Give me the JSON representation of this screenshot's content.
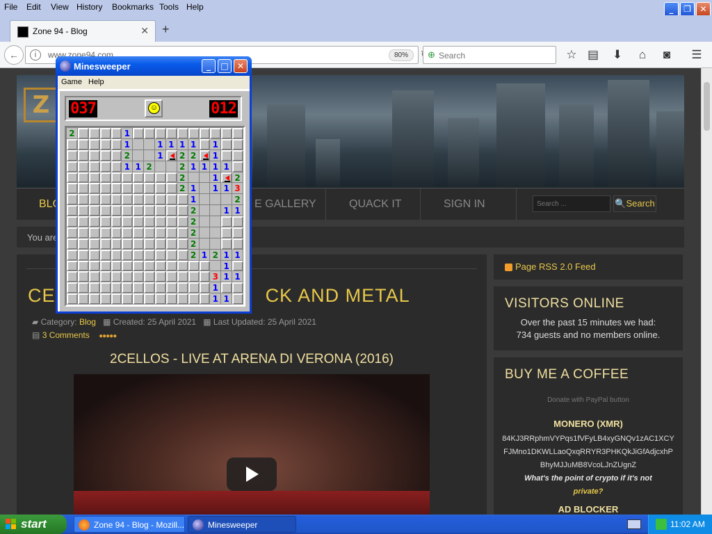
{
  "firefox": {
    "menu": [
      "File",
      "Edit",
      "View",
      "History",
      "Bookmarks",
      "Tools",
      "Help"
    ],
    "tab_title": "Zone 94 - Blog",
    "url": "www.zone94.com",
    "zoom": "80%",
    "search_placeholder": "Search"
  },
  "site": {
    "nav": [
      "BLO",
      "E GALLERY",
      "QUACK IT",
      "SIGN IN"
    ],
    "search_placeholder": "Search ...",
    "search_button": "Search",
    "breadcrumb": "You are",
    "article": {
      "title_left": "CEL",
      "title_right": "CK AND METAL",
      "category_label": "Category:",
      "category": "Blog",
      "created": "Created: 25 April 2021",
      "updated": "Last Updated: 25 April 2021",
      "comments": "3 Comments",
      "video_title": "2CELLOS - LIVE AT ARENA DI VERONA (2016)"
    },
    "sidebar": {
      "rss": "Page RSS 2.0 Feed",
      "visitors_title": "VISITORS ONLINE",
      "visitors_line1": "Over the past 15 minutes we had:",
      "visitors_line2": "734 guests and no members online.",
      "coffee_title": "BUY ME A COFFEE",
      "donate": "Donate with PayPal button",
      "monero_title": "MONERO (XMR)",
      "monero_addr1": "84KJ3RRphmVYPqs1fVFyLB4xyGNQv1zAC1XCY",
      "monero_addr2": "FJMno1DKWLLaoQxqRRYR3PHKQkJiGfAdjcxhP",
      "monero_addr3": "BhyMJJuMB8VcoLJnZUgnZ",
      "question1": "What's the point of crypto if it's not",
      "question2": "private?",
      "adblocker": "AD BLOCKER"
    }
  },
  "minesweeper": {
    "title": "Minesweeper",
    "menu": [
      "Game",
      "Help"
    ],
    "mines_left": "037",
    "time": "012",
    "face": "smiley",
    "grid_size": 16,
    "grid": [
      "2UUUU1UUUUUUUUUU",
      "UUUUU1..1111U1UU",
      "UUUUU2..1F22F1UU",
      "UUUUU112..21111U",
      "UUUUUUUUUU2..1F2",
      "UUUUUUUUUU21.113",
      "UUUUUUUUUUU1...2",
      "UUUUUUUUUUU2..11",
      "UUUUUUUUUUU2..UU",
      "UUUUUUUUUUU2..UU",
      "UUUUUUUUUUU2..UU",
      "UUUUUUUUUUU212111",
      "UUUUUUUUUUUUU.1",
      "UUUUUUUUUUUUU311",
      "UUUUUUUUUUUUU1UU",
      "UUUUUUUUUUUUU11U"
    ]
  },
  "taskbar": {
    "start": "start",
    "tasks": [
      "Zone 94 - Blog - Mozill...",
      "Minesweeper"
    ],
    "clock": "11:02 AM"
  }
}
